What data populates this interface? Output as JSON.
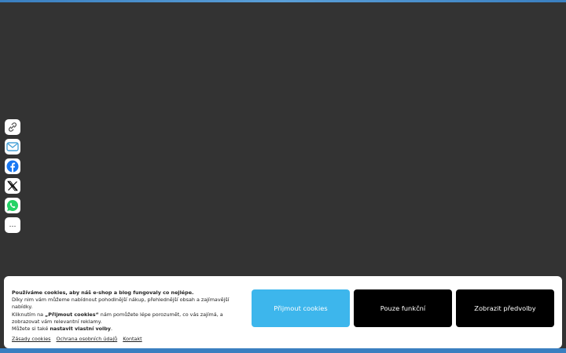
{
  "share": {
    "items": [
      {
        "icon": "link-icon"
      },
      {
        "icon": "mail-icon"
      },
      {
        "icon": "facebook-icon"
      },
      {
        "icon": "x-icon"
      },
      {
        "icon": "whatsapp-icon"
      },
      {
        "icon": "more-icon",
        "label": "…"
      }
    ]
  },
  "cookies": {
    "headline": "Používáme cookies, aby náš e-shop a blog fungovaly co nejlépe.",
    "line1": "Díky nim vám můžeme nabídnout pohodlnější nákup, přehlednější obsah a zajímavější nabídky.",
    "line2_before": "Kliknutím na ",
    "line2_bold": "„Přijmout cookies“",
    "line2_after": " nám pomůžete lépe porozumět, co vás zajímá, a zobrazovat vám relevantní reklamy.",
    "line3_before": "Můžete si také ",
    "line3_bold": "nastavit vlastní volby",
    "line3_after": ".",
    "links": [
      "Zásady cookies",
      "Ochrana osobních údajů",
      "Kontakt"
    ],
    "buttons": {
      "accept": "Přijmout cookies",
      "functional": "Pouze funkční",
      "preferences": "Zobrazit předvolby"
    }
  },
  "colors": {
    "background": "#333333",
    "accent": "#3db6ec",
    "facebook": "#1877f2",
    "whatsapp": "#25d366"
  }
}
